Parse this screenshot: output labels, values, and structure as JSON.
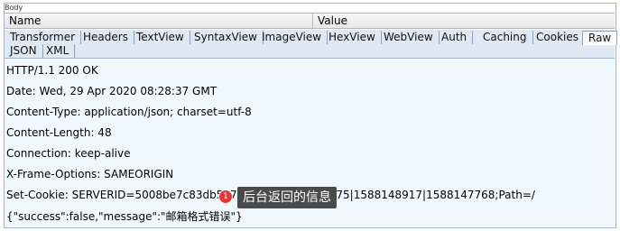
{
  "section": {
    "label": "Body"
  },
  "columns": {
    "name": "Name",
    "value": "Value"
  },
  "tabs": {
    "row1": [
      "Transformer",
      "Headers",
      "TextView",
      "SyntaxView",
      "ImageView",
      "HexView",
      "WebView",
      "Auth",
      "Caching",
      "Cookies",
      "Raw"
    ],
    "row2": [
      "JSON",
      "XML"
    ],
    "active": "Raw"
  },
  "response": {
    "lines": [
      "HTTP/1.1 200 OK",
      "Date: Wed, 29 Apr 2020 08:28:37 GMT",
      "Content-Type: application/json; charset=utf-8",
      "Content-Length: 48",
      "Connection: keep-alive",
      "X-Frame-Options: SAMEORIGIN",
      "Set-Cookie: SERVERID=5008be7c83db547211556bacd0f30b75|1588148917|1588147768;Path=/"
    ],
    "body": "{\"success\":false,\"message\":\"邮箱格式错误\"}"
  },
  "annotation": {
    "badge": "1",
    "text": "后台返回的信息",
    "badge_color": "#e5373a"
  }
}
